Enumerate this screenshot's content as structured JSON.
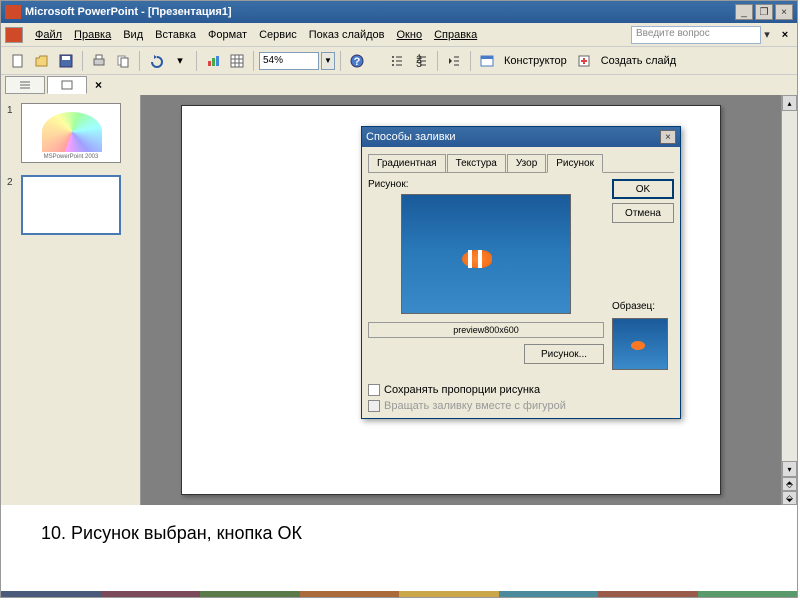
{
  "title_bar": {
    "app_title": "Microsoft PowerPoint - [Презентация1]"
  },
  "menu": {
    "file": "Файл",
    "edit": "Правка",
    "view": "Вид",
    "insert": "Вставка",
    "format": "Формат",
    "tools": "Сервис",
    "slideshow": "Показ слайдов",
    "window": "Окно",
    "help": "Справка",
    "help_placeholder": "Введите вопрос"
  },
  "toolbar": {
    "zoom": "54%",
    "designer": "Конструктор",
    "new_slide": "Создать слайд"
  },
  "slides": {
    "s1": "1",
    "s2": "2",
    "thumb1_label": "MSPowerPoint 2003"
  },
  "dialog": {
    "title": "Способы заливки",
    "tabs": {
      "gradient": "Градиентная",
      "texture": "Текстура",
      "pattern": "Узор",
      "picture": "Рисунок"
    },
    "picture_label": "Рисунок:",
    "preview_text": "preview800x600",
    "browse_btn": "Рисунок...",
    "ok": "OK",
    "cancel": "Отмена",
    "sample_label": "Образец:",
    "lock_aspect": "Сохранять пропорции рисунка",
    "rotate_fill": "Вращать заливку вместе с фигурой"
  },
  "caption": "10.   Рисунок выбран, кнопка ОК"
}
